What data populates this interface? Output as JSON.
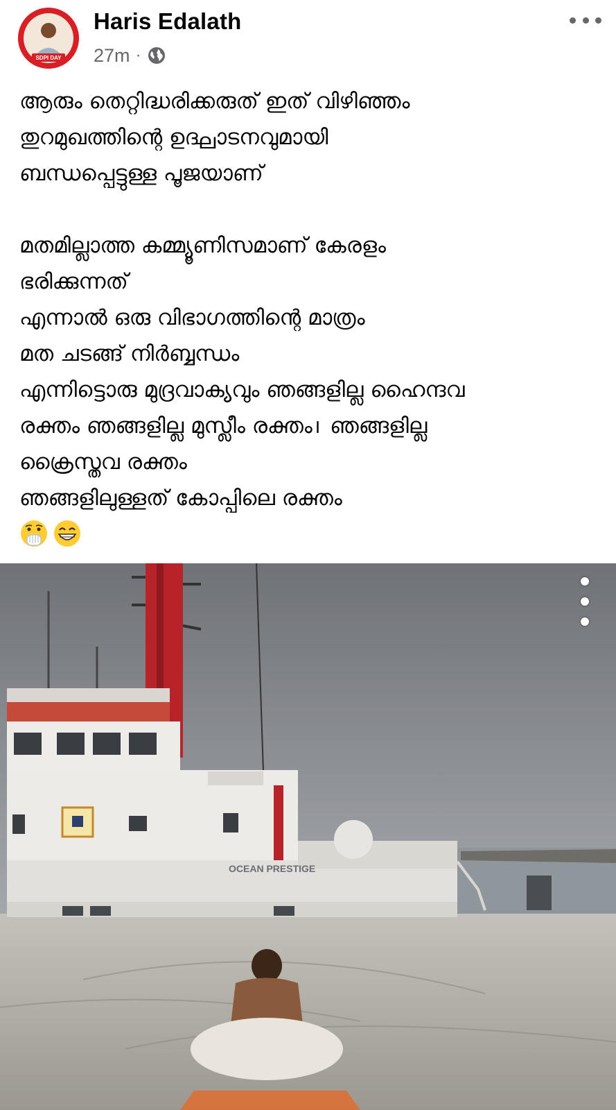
{
  "post": {
    "author": {
      "name": "Haris Edalath",
      "avatar_icon": "profile-photo-icon",
      "avatar_badge_text": "SDPI DAY"
    },
    "time": "27m",
    "separator": "·",
    "privacy_icon": "globe-icon",
    "menu_icon": "more-horizontal-icon",
    "text_lines": [
      "ആരും തെറ്റിദ്ധരിക്കരുത് ഇത് വിഴിഞ്ഞം",
      "തുറമുഖത്തിന്റെ ഉദ്ഘാടനവുമായി",
      "ബന്ധപ്പെട്ടുള്ള പൂജയാണ്",
      "",
      "മതമില്ലാത്ത കമ്മ്യൂണിസമാണ് കേരളം",
      "ഭരിക്കുന്നത്",
      "എന്നാൽ ഒരു വിഭാഗത്തിന്റെ മാത്രം",
      "മത ചടങ്ങ് നിർബ്ബന്ധം",
      "എന്നിട്ടൊരു മുദ്രവാക്യവും ഞങ്ങളില്ല ഹൈന്ദവ",
      "രക്തം ഞങ്ങളില്ല മുസ്ലീം രക്തം। ഞങ്ങളില്ല",
      "ക്രൈസ്തവ രക്തം",
      "ഞങ്ങളിലുള്ളത് കോപ്പിലെ രക്തം"
    ],
    "emojis": [
      "face-with-hand-over-mouth-icon",
      "grinning-face-icon"
    ]
  },
  "photo": {
    "ship_name": "OCEAN PRESTIGE",
    "menu_icon": "more-vertical-icon",
    "colors": {
      "sky": "#8e9196",
      "ship_hull": "#e8e6e2",
      "mast": "#b8232a",
      "dock": "#b9b6b0"
    }
  },
  "colors": {
    "text_primary": "#050505",
    "text_secondary": "#65676b",
    "avatar_ring": "#d71f25"
  }
}
